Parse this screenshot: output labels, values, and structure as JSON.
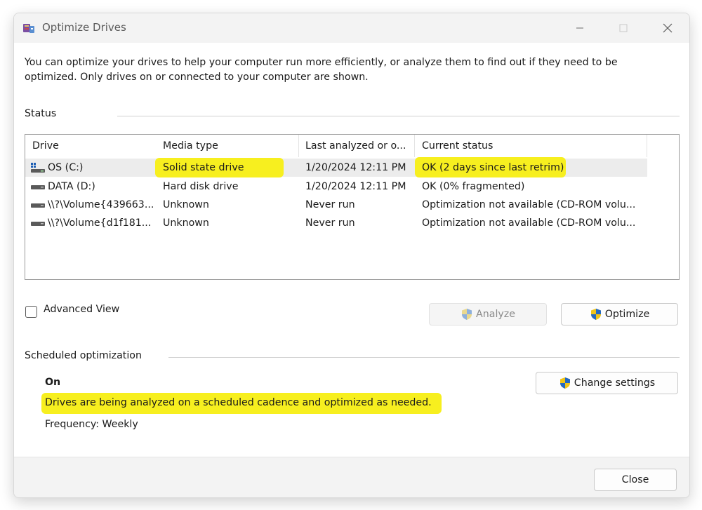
{
  "window": {
    "title": "Optimize Drives"
  },
  "intro": "You can optimize your drives to help your computer run more efficiently, or analyze them to find out if they need to be optimized. Only drives on or connected to your computer are shown.",
  "status": {
    "label": "Status",
    "columns": [
      "Drive",
      "Media type",
      "Last analyzed or o...",
      "Current status"
    ],
    "rows": [
      {
        "drive": "OS (C:)",
        "media": "Solid state drive",
        "last": "1/20/2024 12:11 PM",
        "status": "OK (2 days since last retrim)",
        "icon": "os-drive-icon",
        "selected": true
      },
      {
        "drive": "DATA (D:)",
        "media": "Hard disk drive",
        "last": "1/20/2024 12:11 PM",
        "status": "OK (0% fragmented)",
        "icon": "hard-drive-icon",
        "selected": false
      },
      {
        "drive": "\\\\?\\Volume{439663...",
        "media": "Unknown",
        "last": "Never run",
        "status": "Optimization not available (CD-ROM volu...",
        "icon": "hard-drive-icon",
        "selected": false
      },
      {
        "drive": "\\\\?\\Volume{d1f181...",
        "media": "Unknown",
        "last": "Never run",
        "status": "Optimization not available (CD-ROM volu...",
        "icon": "hard-drive-icon",
        "selected": false
      }
    ]
  },
  "advanced_view": {
    "label": "Advanced View",
    "checked": false
  },
  "buttons": {
    "analyze": "Analyze",
    "optimize": "Optimize",
    "change_settings": "Change settings",
    "close": "Close"
  },
  "scheduled": {
    "label": "Scheduled optimization",
    "state": "On",
    "description": "Drives are being analyzed on a scheduled cadence and optimized as needed.",
    "frequency": "Frequency: Weekly"
  },
  "colors": {
    "highlight": "#f7ef1f",
    "selected_row": "#ececec",
    "titlebar": "#f3f3f3"
  }
}
